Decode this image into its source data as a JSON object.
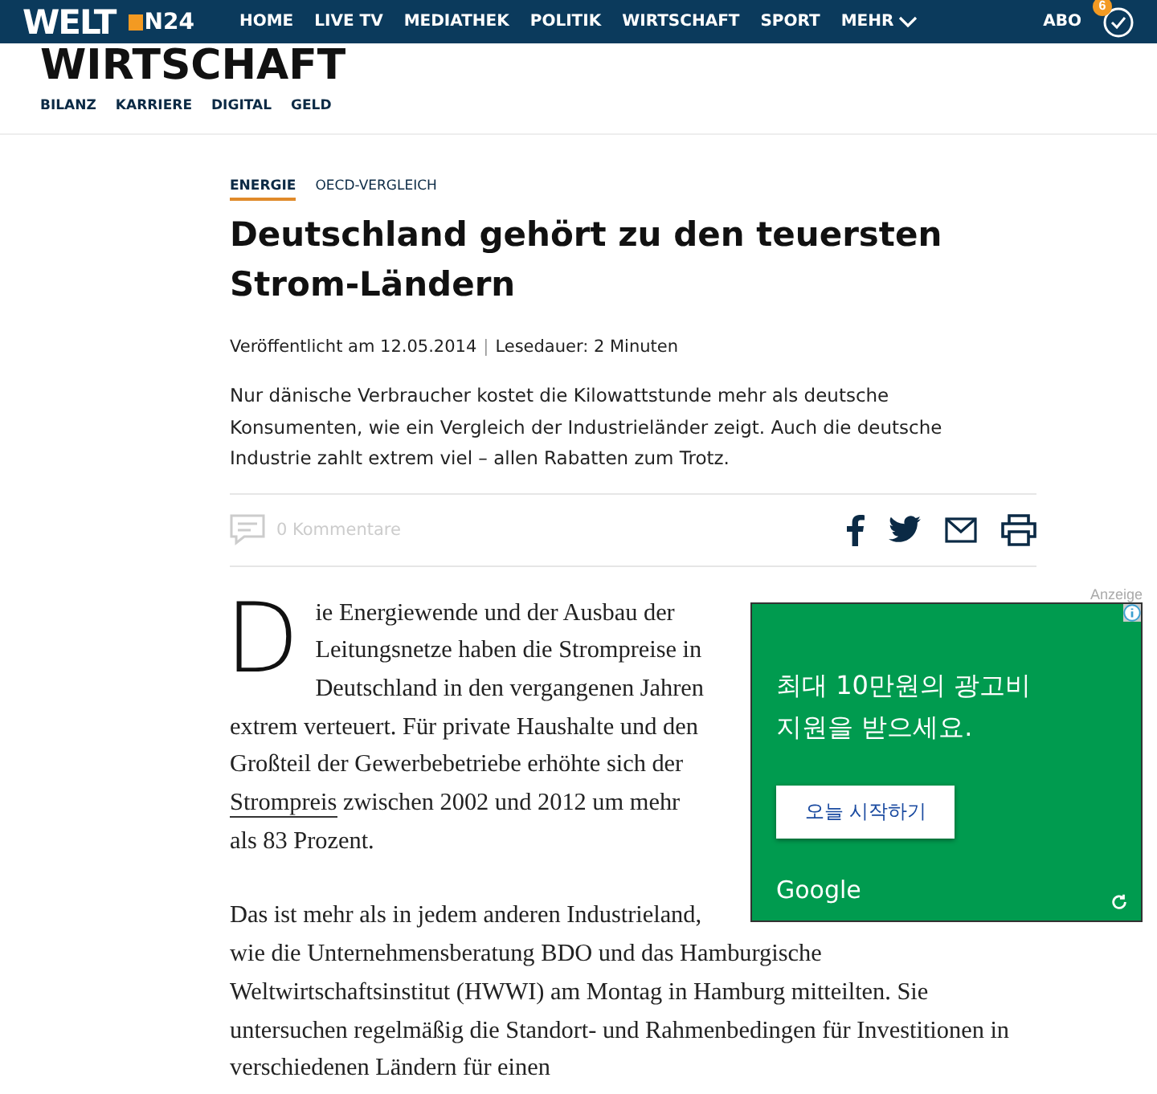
{
  "header": {
    "logo": "WELT",
    "logo_sub": "N24",
    "nav_items": [
      "HOME",
      "LIVE TV",
      "MEDIATHEK",
      "POLITIK",
      "WIRTSCHAFT",
      "SPORT"
    ],
    "more": "MEHR",
    "abo": "ABO",
    "badge": "6"
  },
  "section": {
    "title": "WIRTSCHAFT",
    "subnav": [
      "BILANZ",
      "KARRIERE",
      "DIGITAL",
      "GELD"
    ]
  },
  "article": {
    "tags": [
      {
        "label": "ENERGIE",
        "selected": true
      },
      {
        "label": "OECD-VERGLEICH",
        "selected": false
      }
    ],
    "headline": "Deutschland gehört zu den teuersten Strom-Ländern",
    "published": "Veröffentlicht am 12.05.2014",
    "separator": "|",
    "reading_time": "Lesedauer: 2 Minuten",
    "intro": "Nur dänische Verbraucher kostet die Kilowattstunde mehr als deutsche Konsumenten, wie ein Vergleich der Industrieländer zeigt. Auch die deutsche Industrie zahlt extrem viel – allen Rabatten zum Trotz.",
    "comments": "0 Kommentare",
    "drop_cap": "D",
    "p1_before": "ie Energiewende und der Ausbau der Leitungsnetze haben die Strompreise in Deutschland in den vergangenen Jahren extrem verteuert. Für private Haushalte und den Großteil der Gewerbebetriebe erhöhte sich der",
    "p1_link": "Strompreis",
    "p1_after": "zwischen 2002 und 2012 um mehr als 83 Prozent.",
    "p2": "Das ist mehr als in jedem anderen Industrieland, wie die Unternehmensberatung BDO und das Hamburgische Weltwirtschaftsinstitut (HWWI) am Montag in Hamburg mitteilten. Sie untersuchen regelmäßig die Standort- und Rahmenbedingen für Investitionen in verschiedenen Ländern für einen"
  },
  "ad": {
    "label": "Anzeige",
    "text": "최대 10만원의 광고비 지원을 받으세요.",
    "button": "오늘 시작하기",
    "brand": "Google"
  }
}
